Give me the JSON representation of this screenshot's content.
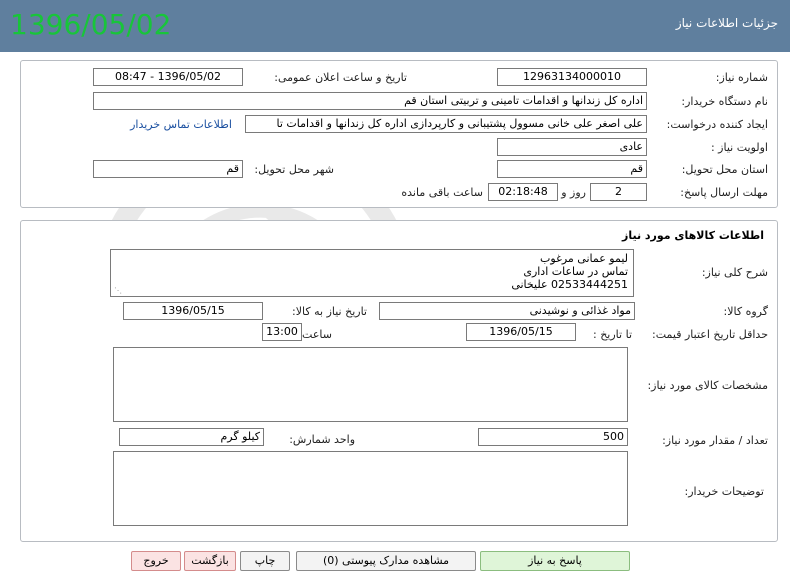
{
  "header": {
    "title": "جزئیات اطلاعات نیاز",
    "date_stamp": "1396/05/02"
  },
  "need": {
    "number_label": "شماره نیاز:",
    "number": "12963134000010",
    "announce_label": "تاریخ و ساعت اعلان عمومی:",
    "announce": "1396/05/02 - 08:47",
    "buyer_label": "نام دستگاه خریدار:",
    "buyer": "اداره کل زندانها و اقدامات تامینی و تربیتی استان قم",
    "creator_label": "ایجاد کننده درخواست:",
    "creator": "علی اصغر علی خانی مسوول پشتیبانی و کارپردازی اداره کل زندانها و اقدامات تا",
    "contact_link": "اطلاعات تماس خریدار",
    "priority_label": "اولویت نیاز :",
    "priority": "عادی",
    "province_label": "استان محل تحویل:",
    "province": "قم",
    "city_label": "شهر محل تحویل:",
    "city": "قم",
    "deadline_label": "مهلت ارسال پاسخ:",
    "days": "2",
    "days_suffix": "روز و",
    "time_left": "02:18:48",
    "time_left_suffix": "ساعت باقی مانده"
  },
  "goods": {
    "section_title": "اطلاعات کالاهای مورد نیاز",
    "desc_label": "شرح کلی نیاز:",
    "desc_lines": [
      "لیمو عمانی مرغوب",
      "تماس در ساعات اداری",
      "02533444251 علیخانی"
    ],
    "group_label": "گروه کالا:",
    "group": "مواد غذائی و نوشیدنی",
    "need_date_label": "تاریخ نیاز به کالا:",
    "need_date": "1396/05/15",
    "validity_label": "حداقل تاریخ اعتبار قیمت:",
    "until_label": "تا تاریخ :",
    "until_date": "1396/05/15",
    "time_label": "ساعت :",
    "time": "13:00",
    "specs_label": "مشخصات کالای مورد نیاز:",
    "qty_label": "تعداد / مقدار مورد نیاز:",
    "qty": "500",
    "unit_label": "واحد شمارش:",
    "unit": "کیلو گرم",
    "notes_label": "توضیحات خریدار:"
  },
  "actions": {
    "respond": "پاسخ به نیاز",
    "attachments": "مشاهده مدارک پیوستی (0)",
    "print": "چاپ",
    "back": "بازگشت",
    "exit": "خروج"
  },
  "colors": {
    "header_bg": "#5f7f9e",
    "date_stamp": "#18c53a",
    "link": "#1a4fa0"
  }
}
